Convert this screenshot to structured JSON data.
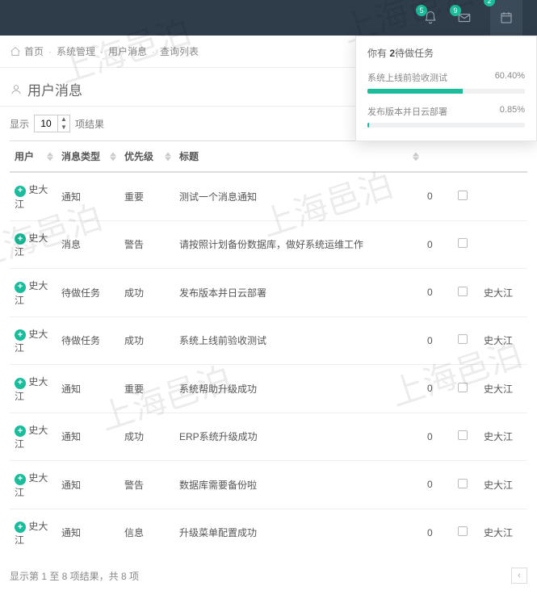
{
  "watermark": "上海邑泊",
  "topbar": {
    "badge1": "5",
    "badge2": "9",
    "badge3": "2"
  },
  "breadcrumb": {
    "home": "首页",
    "sys": "系统管理",
    "msg": "用户消息",
    "list": "查询列表"
  },
  "page_title": "用户消息",
  "len": {
    "show": "显示",
    "value": "10",
    "unit": "项结果"
  },
  "cols": {
    "user": "用户",
    "type": "消息类型",
    "prio": "优先级",
    "title": "标题",
    "count": "",
    "chk": "",
    "owner": ""
  },
  "rows": [
    {
      "user": "史大江",
      "type": "通知",
      "prio": "重要",
      "title": "测试一个消息通知",
      "count": "0",
      "owner": ""
    },
    {
      "user": "史大江",
      "type": "消息",
      "prio": "警告",
      "title": "请按照计划备份数据库，做好系统运维工作",
      "count": "0",
      "owner": ""
    },
    {
      "user": "史大江",
      "type": "待做任务",
      "prio": "成功",
      "title": "发布版本并日云部署",
      "count": "0",
      "owner": "史大江"
    },
    {
      "user": "史大江",
      "type": "待做任务",
      "prio": "成功",
      "title": "系统上线前验收测试",
      "count": "0",
      "owner": "史大江"
    },
    {
      "user": "史大江",
      "type": "通知",
      "prio": "重要",
      "title": "系统帮助升级成功",
      "count": "0",
      "owner": "史大江"
    },
    {
      "user": "史大江",
      "type": "通知",
      "prio": "成功",
      "title": "ERP系统升级成功",
      "count": "0",
      "owner": "史大江"
    },
    {
      "user": "史大江",
      "type": "通知",
      "prio": "警告",
      "title": "数据库需要备份啦",
      "count": "0",
      "owner": "史大江"
    },
    {
      "user": "史大江",
      "type": "通知",
      "prio": "信息",
      "title": "升级菜单配置成功",
      "count": "0",
      "owner": "史大江"
    }
  ],
  "footer": "显示第 1 至 8 项结果，共 8 项",
  "pop": {
    "prefix": "你有 ",
    "bold": "2",
    "suffix": "待做任务",
    "tasks": [
      {
        "name": "系统上线前验收测试",
        "pct_label": "60.40%",
        "pct": 60.4
      },
      {
        "name": "发布版本并日云部署",
        "pct_label": "0.85%",
        "pct": 0.85
      }
    ]
  }
}
